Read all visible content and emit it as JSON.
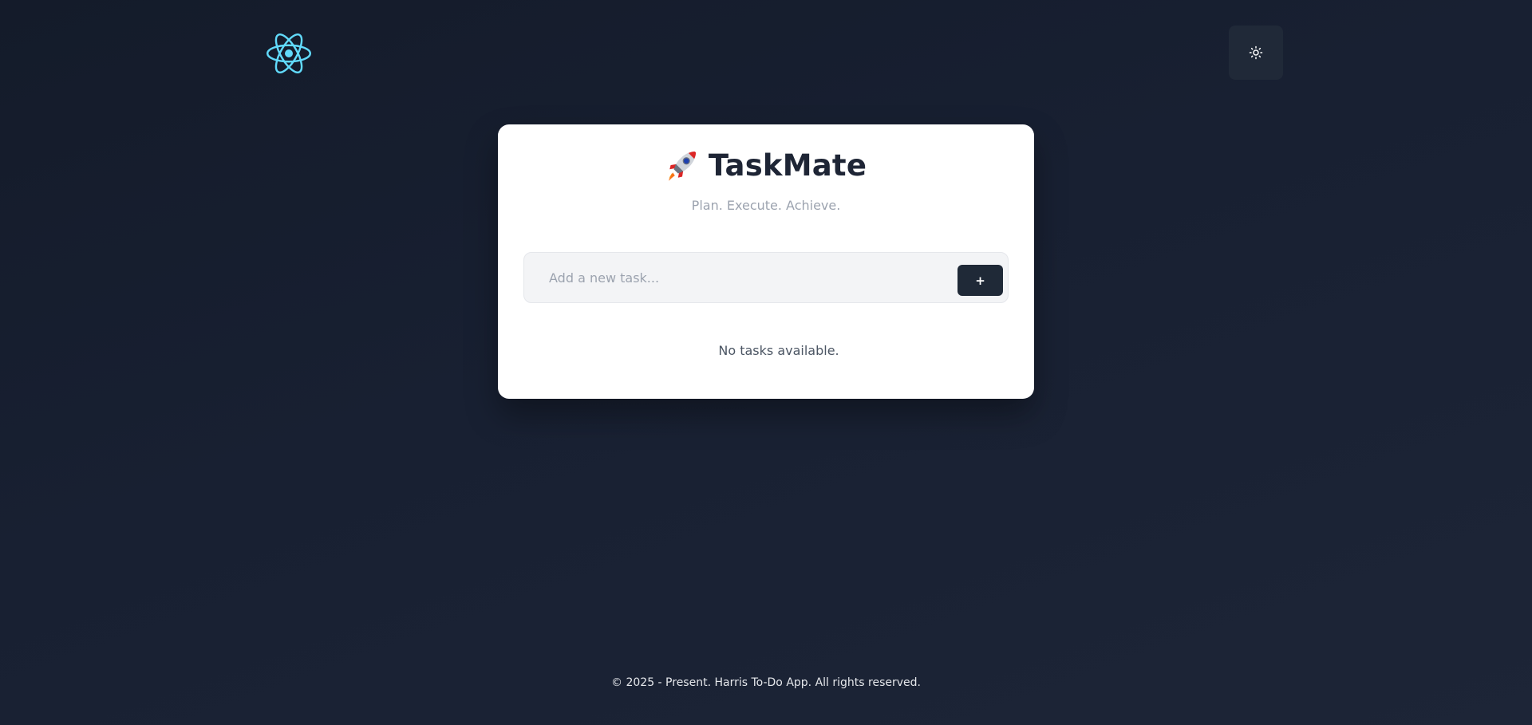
{
  "header": {
    "logo_icon": "react-atom-icon",
    "theme_toggle_icon": "sun-icon"
  },
  "app": {
    "title": "TaskMate",
    "title_icon": "rocket-icon",
    "tagline": "Plan. Execute. Achieve."
  },
  "task_form": {
    "placeholder": "Add a new task...",
    "value": "",
    "add_label": "+"
  },
  "tasks": {
    "items": [],
    "empty_message": "No tasks available."
  },
  "footer": {
    "text": "© 2025 - Present. Harris To-Do App. All rights reserved."
  },
  "colors": {
    "background": "#172033",
    "card": "#ffffff",
    "accent": "#61dafb",
    "button": "#1f2937",
    "input_bg": "#f3f4f6"
  }
}
